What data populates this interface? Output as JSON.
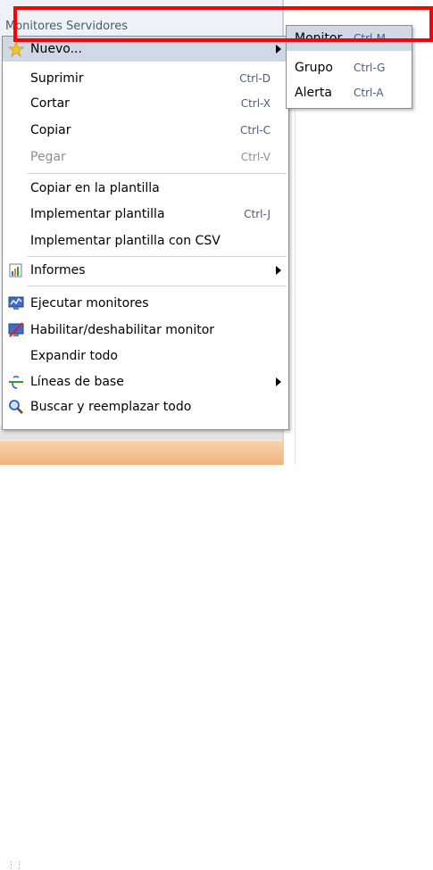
{
  "background": {
    "header_text": "Monitores Servidores"
  },
  "menu": {
    "items": [
      {
        "label": "Nuevo...",
        "shortcut": ""
      },
      {
        "label": "Suprimir",
        "shortcut": "Ctrl-D"
      },
      {
        "label": "Cortar",
        "shortcut": "Ctrl-X"
      },
      {
        "label": "Copiar",
        "shortcut": "Ctrl-C"
      },
      {
        "label": "Pegar",
        "shortcut": "Ctrl-V"
      },
      {
        "label": "Copiar en la plantilla",
        "shortcut": ""
      },
      {
        "label": "Implementar plantilla",
        "shortcut": "Ctrl-J"
      },
      {
        "label": "Implementar plantilla con CSV",
        "shortcut": ""
      },
      {
        "label": "Informes",
        "shortcut": ""
      },
      {
        "label": "Ejecutar monitores",
        "shortcut": ""
      },
      {
        "label": "Habilitar/deshabilitar monitor",
        "shortcut": ""
      },
      {
        "label": "Expandir todo",
        "shortcut": ""
      },
      {
        "label": "Líneas de base",
        "shortcut": ""
      },
      {
        "label": "Buscar y reemplazar todo",
        "shortcut": ""
      }
    ]
  },
  "submenu": {
    "items": [
      {
        "label": "Monitor",
        "shortcut": "Ctrl-M"
      },
      {
        "label": "Grupo",
        "shortcut": "Ctrl-G"
      },
      {
        "label": "Alerta",
        "shortcut": "Ctrl-A"
      }
    ]
  },
  "colors": {
    "highlight": "#cfd8e4",
    "shortcut_text": "#4b5a86",
    "annotation": "#ff0000",
    "disabled_text": "#8f8f8f"
  }
}
